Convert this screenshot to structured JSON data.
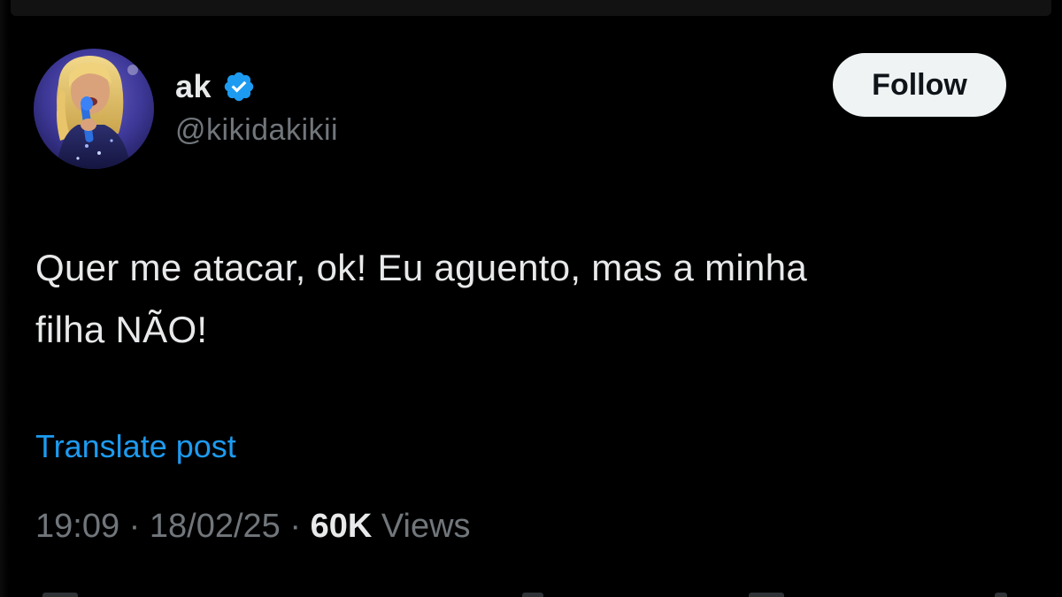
{
  "tweet": {
    "display_name": "ak",
    "handle": "@kikidakikii",
    "verified": true,
    "follow_label": "Follow",
    "text_line_1": "Quer me atacar, ok! Eu aguento, mas a minha",
    "text_line_2": "filha NÃO!",
    "translate_label": "Translate post",
    "time": "19:09",
    "date": "18/02/25",
    "separator": " · ",
    "views_count": "60K",
    "views_label": "Views"
  },
  "colors": {
    "background": "#000000",
    "primary_text": "#e7e9ea",
    "secondary_text": "#71767b",
    "link": "#1d9bf0",
    "verified_badge": "#1d9bf0",
    "follow_button_bg": "#eff3f4"
  },
  "icons": {
    "verified": "verified-badge-icon",
    "avatar": "profile-photo"
  }
}
